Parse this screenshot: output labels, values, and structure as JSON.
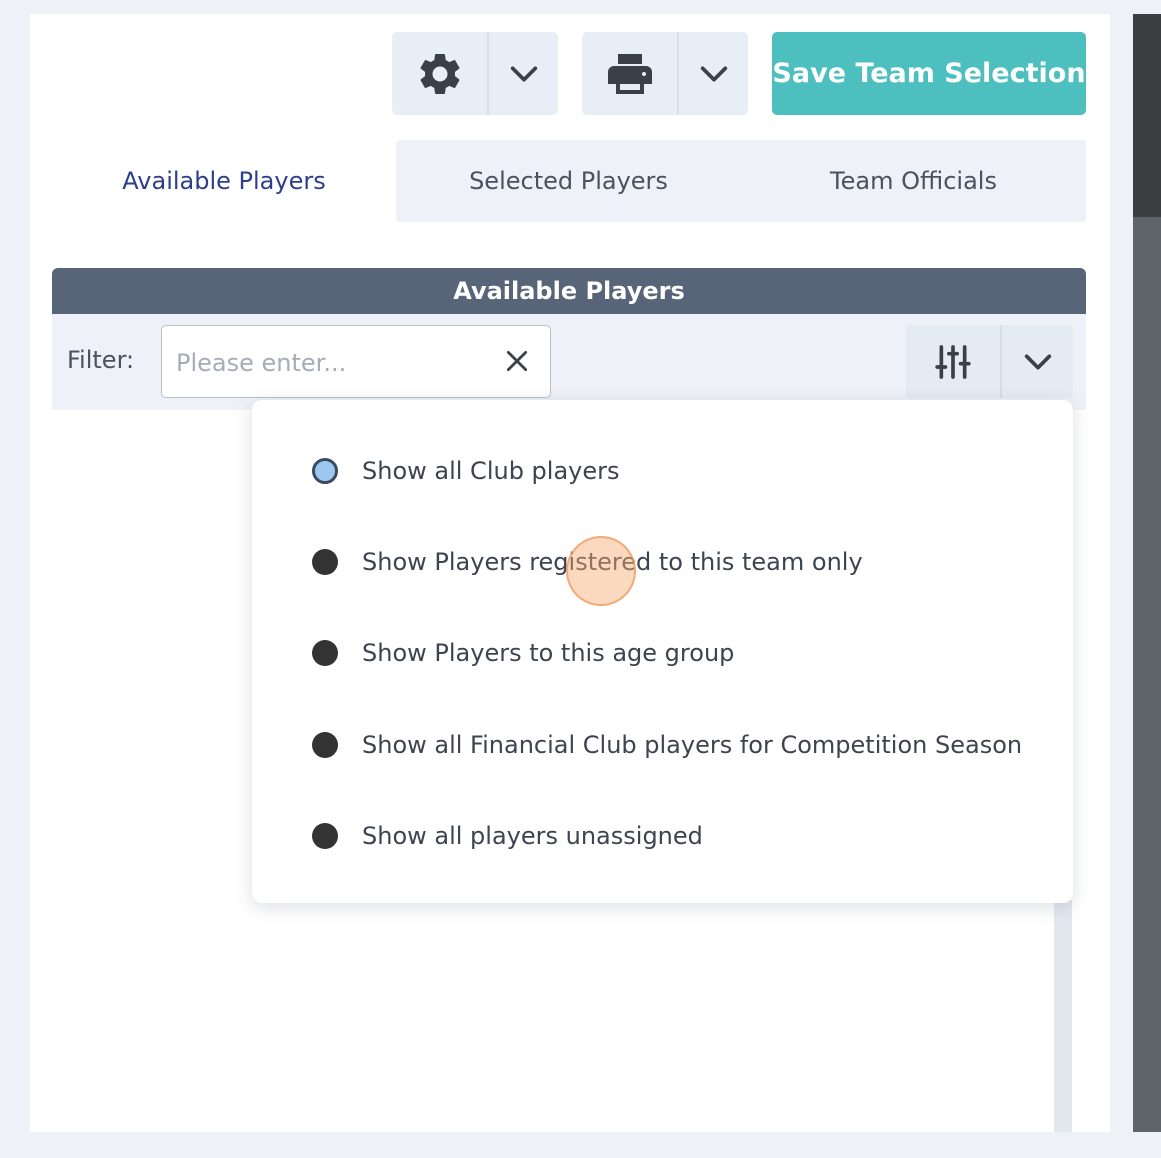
{
  "toolbar": {
    "settings_icon": "gear-icon",
    "print_icon": "printer-icon",
    "save_label": "Save Team Selection",
    "accent": "#4dbfbf"
  },
  "tabs": [
    {
      "label": "Available Players",
      "active": true
    },
    {
      "label": "Selected Players",
      "active": false
    },
    {
      "label": "Team Officials",
      "active": false
    }
  ],
  "section": {
    "title": "Available Players"
  },
  "filter": {
    "label": "Filter:",
    "placeholder": "Please enter...",
    "value": ""
  },
  "dropdown": {
    "options": [
      {
        "label": "Show all Club players",
        "selected": true
      },
      {
        "label": "Show Players registered to this team only",
        "selected": false
      },
      {
        "label": "Show Players to this age group",
        "selected": false
      },
      {
        "label": "Show all Financial Club players for Competition Season",
        "selected": false
      },
      {
        "label": "Show all players unassigned",
        "selected": false
      }
    ]
  }
}
